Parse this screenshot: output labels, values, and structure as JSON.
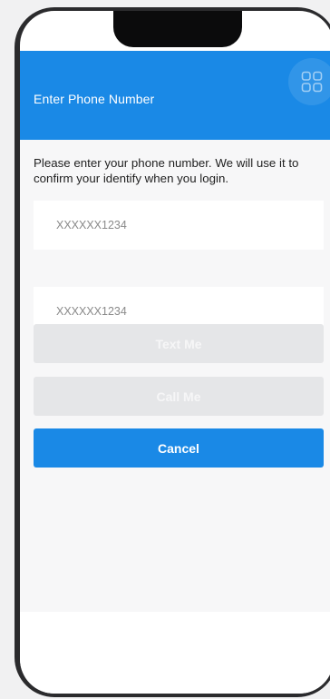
{
  "header": {
    "title": "Enter Phone Number",
    "menu_icon": "grid-icon",
    "background_color": "#1a89e6"
  },
  "instruction": "Please enter your phone number. We will use it to confirm your identify when you login.",
  "phone_field": {
    "placeholder": "XXXXXX1234",
    "value": ""
  },
  "confirm_field": {
    "placeholder": "XXXXXX1234",
    "value": ""
  },
  "buttons": {
    "text_me": "Text Me",
    "call_me": "Call Me",
    "cancel": "Cancel"
  },
  "colors": {
    "accent": "#1a89e6",
    "disabled_button": "#e5e6e8",
    "page_background": "#f7f7f8"
  }
}
